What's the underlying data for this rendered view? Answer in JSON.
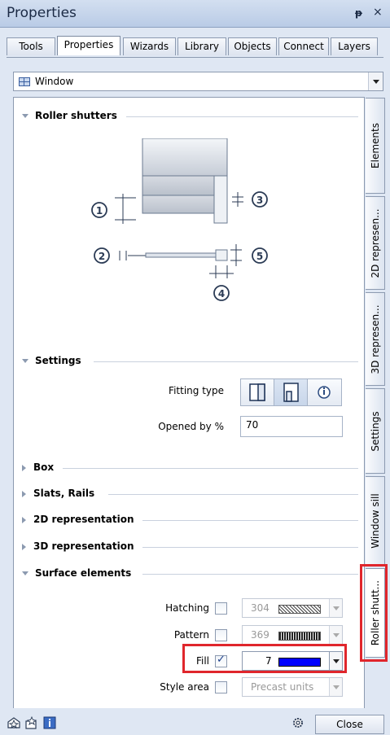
{
  "window": {
    "title": "Properties",
    "pin_glyph": "ᵽ",
    "close_glyph": "×"
  },
  "tabs": [
    {
      "label": "Tools"
    },
    {
      "label": "Properties",
      "active": true
    },
    {
      "label": "Wizards"
    },
    {
      "label": "Library"
    },
    {
      "label": "Objects"
    },
    {
      "label": "Connect"
    },
    {
      "label": "Layers"
    }
  ],
  "object_select": {
    "value": "Window",
    "icon": "window-grid-icon"
  },
  "sections": {
    "roller_shutters": "Roller shutters",
    "settings": "Settings",
    "box": "Box",
    "slats_rails": "Slats, Rails",
    "representation_2d": "2D representation",
    "representation_3d": "3D representation",
    "surface_elements": "Surface elements"
  },
  "diagram": {
    "markers": [
      "1",
      "2",
      "3",
      "4",
      "5"
    ]
  },
  "settings": {
    "fitting_type_label": "Fitting type",
    "opened_by_label": "Opened by %",
    "opened_by_value": "70"
  },
  "surface": {
    "hatching": {
      "label": "Hatching",
      "checked": false,
      "value": "304"
    },
    "pattern": {
      "label": "Pattern",
      "checked": false,
      "value": "369"
    },
    "fill": {
      "label": "Fill",
      "checked": true,
      "value": "7",
      "color": "#0000ff"
    },
    "style_area": {
      "label": "Style area",
      "checked": false,
      "value": "Precast units"
    }
  },
  "side_tabs": [
    {
      "label": "Elements"
    },
    {
      "label": "2D represen..."
    },
    {
      "label": "3D represen..."
    },
    {
      "label": "Settings"
    },
    {
      "label": "Window sill"
    },
    {
      "label": "Roller shutt...",
      "active": true
    }
  ],
  "footer": {
    "close_label": "Close"
  },
  "colors": {
    "highlight": "#e0262c",
    "accent": "#3a5fa0"
  }
}
